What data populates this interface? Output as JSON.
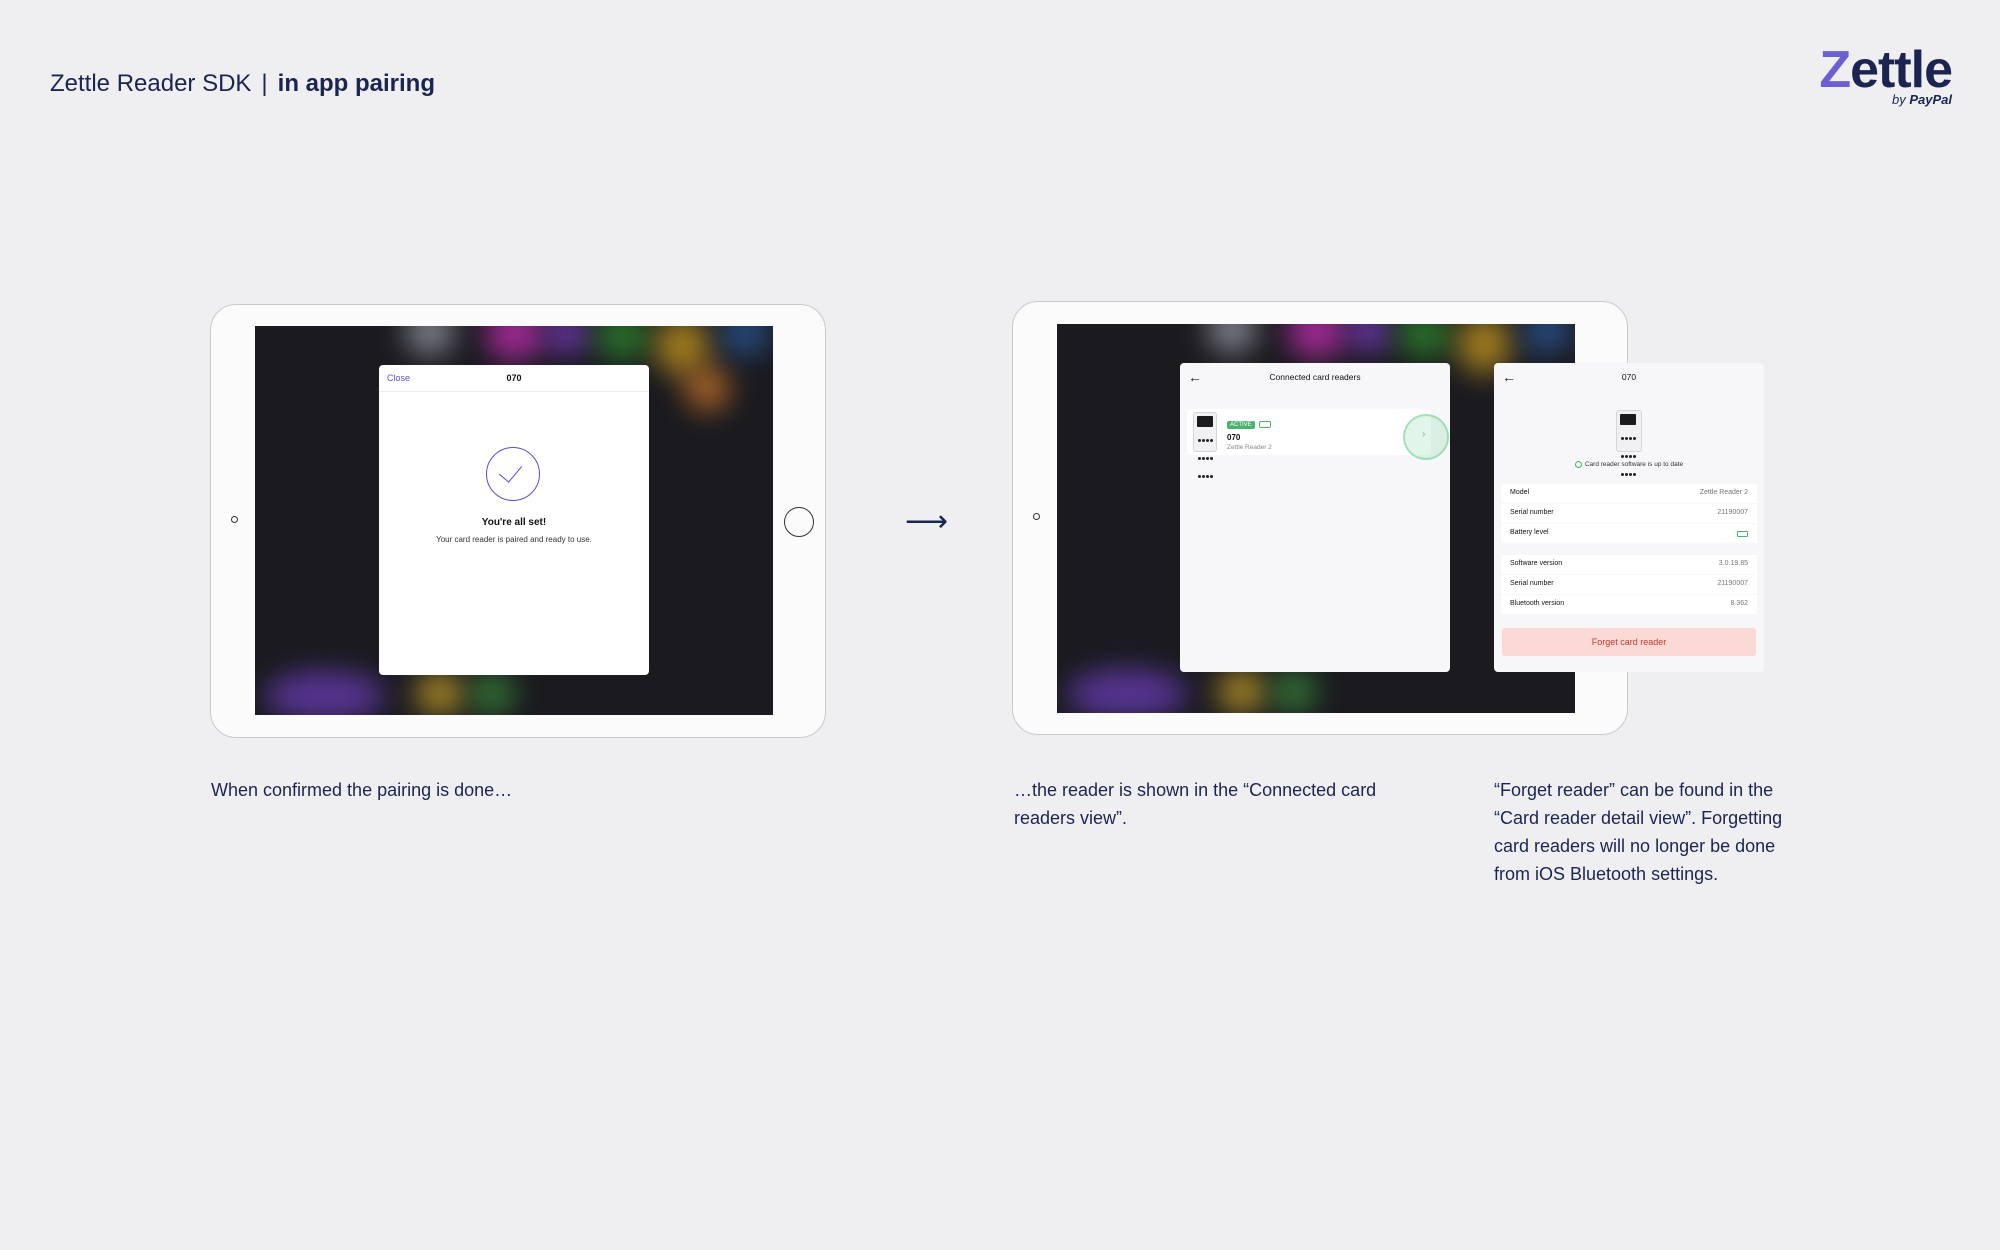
{
  "header": {
    "title_light": "Zettle Reader SDK",
    "separator": "|",
    "title_bold": "in app pairing"
  },
  "logo": {
    "word_first": "Z",
    "word_rest": "ettle",
    "by": "by",
    "by_brand": "PayPal"
  },
  "arrow": "⟶",
  "screen1": {
    "close": "Close",
    "title": "070",
    "heading": "You're all set!",
    "body": "Your card reader is paired and ready to use."
  },
  "screen2": {
    "back": "←",
    "title": "Connected card readers",
    "badge": "ACTIVE",
    "reader_name": "070",
    "reader_model": "Zettle Reader 2",
    "chevron": "›"
  },
  "screen3": {
    "back": "←",
    "title": "070",
    "status": "Card reader software is up to date",
    "rows_top": [
      {
        "label": "Model",
        "value": "Zettle Reader 2"
      },
      {
        "label": "Serial number",
        "value": "21190007"
      },
      {
        "label": "Battery level",
        "value": ""
      }
    ],
    "rows_bottom": [
      {
        "label": "Software version",
        "value": "3.0.19.85"
      },
      {
        "label": "Serial number",
        "value": "21190007"
      },
      {
        "label": "Bluetooth version",
        "value": "8.362"
      }
    ],
    "forget_button": "Forget card reader"
  },
  "captions": {
    "first": "When confirmed the pairing is done…",
    "second": "…the reader is shown in the “Connected card readers view”.",
    "third": "“Forget reader” can be found in the “Card reader detail view”. Forgetting card readers will no longer be done from iOS Bluetooth settings."
  },
  "colors": {
    "background": "#efeff1",
    "navy": "#1c2550",
    "accent_purple": "#5a4fd0",
    "active_green": "#4ab36d",
    "forget_red": "#c23a2b"
  }
}
